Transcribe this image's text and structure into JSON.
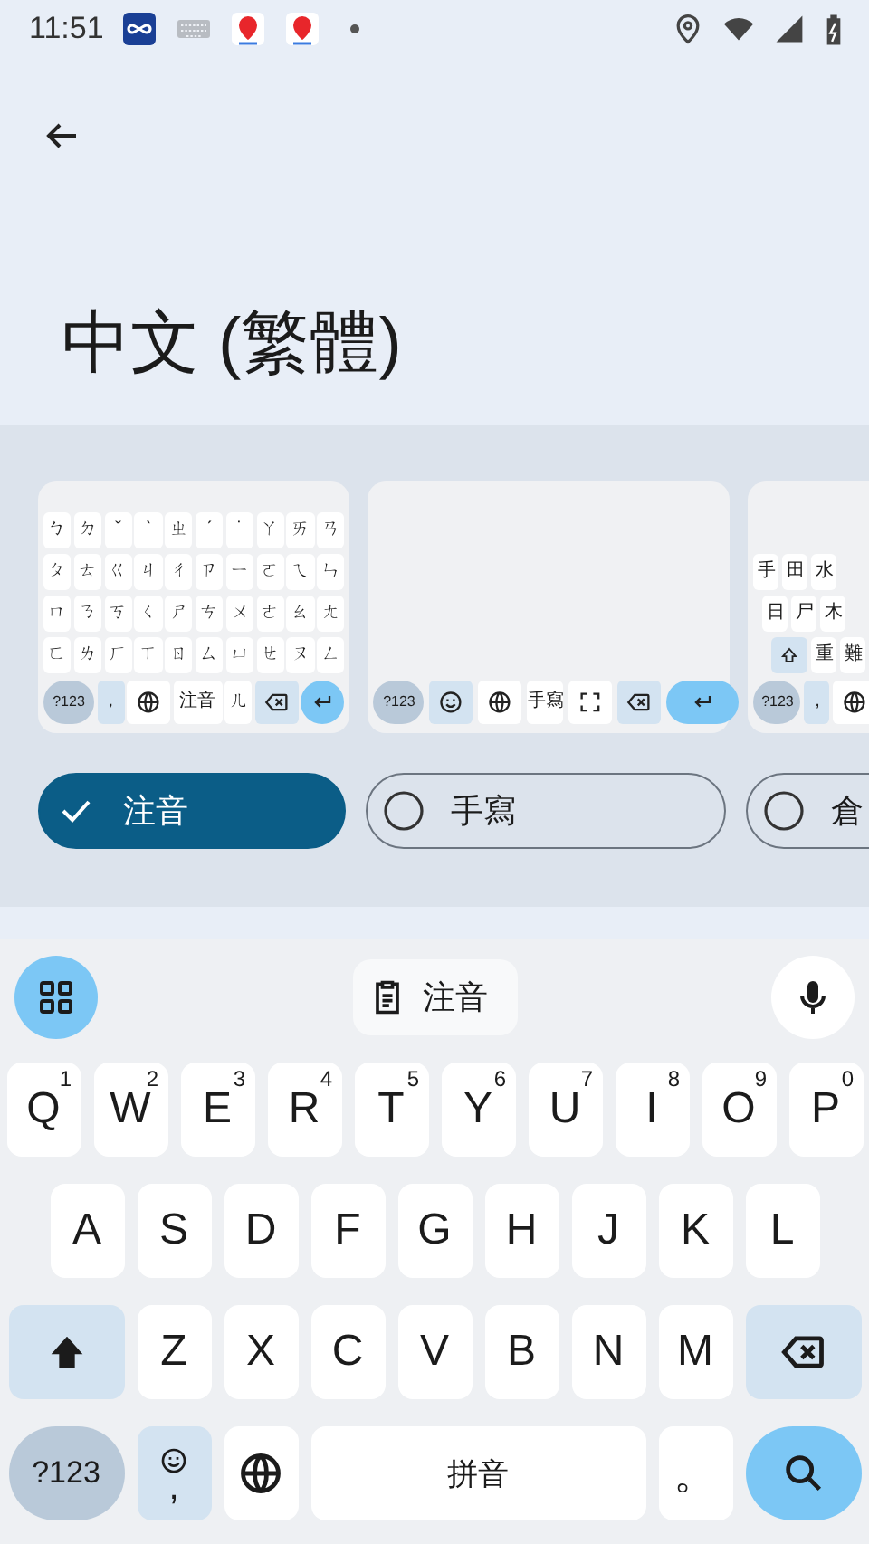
{
  "status_bar": {
    "time": "11:51"
  },
  "title": "中文 (繁體)",
  "layouts": [
    {
      "label": "注音",
      "selected": true,
      "rows": [
        [
          "ㄅ",
          "ㄉ",
          "ˇ",
          "ˋ",
          "ㄓ",
          "ˊ",
          "˙",
          "ㄚ",
          "ㄞ",
          "ㄢ"
        ],
        [
          "ㄆ",
          "ㄊ",
          "ㄍ",
          "ㄐ",
          "ㄔ",
          "ㄗ",
          "ㄧ",
          "ㄛ",
          "ㄟ",
          "ㄣ"
        ],
        [
          "ㄇ",
          "ㄋ",
          "ㄎ",
          "ㄑ",
          "ㄕ",
          "ㄘ",
          "ㄨ",
          "ㄜ",
          "ㄠ",
          "ㄤ"
        ],
        [
          "ㄈ",
          "ㄌ",
          "ㄏ",
          "ㄒ",
          "ㄖ",
          "ㄙ",
          "ㄩ",
          "ㄝ",
          "ㄡ",
          "ㄥ"
        ]
      ],
      "bottom": [
        {
          "kind": "symbols",
          "label": "?123"
        },
        {
          "kind": "comma",
          "label": "，"
        },
        {
          "kind": "globe"
        },
        {
          "kind": "space",
          "label": "注音"
        },
        {
          "kind": "key",
          "label": "ㄦ"
        },
        {
          "kind": "backspace"
        },
        {
          "kind": "enter"
        }
      ]
    },
    {
      "label": "手寫",
      "selected": false,
      "bottom": [
        {
          "kind": "symbols",
          "label": "?123"
        },
        {
          "kind": "emoji"
        },
        {
          "kind": "globe"
        },
        {
          "kind": "space",
          "label": "手寫"
        },
        {
          "kind": "expand"
        },
        {
          "kind": "backspace"
        },
        {
          "kind": "enter"
        }
      ]
    },
    {
      "label": "倉",
      "selected": false,
      "rows": [
        [
          "手",
          "田",
          "水"
        ],
        [
          "日",
          "尸",
          "木"
        ],
        [
          "重",
          "難"
        ]
      ],
      "bottom": [
        {
          "kind": "symbols",
          "label": "?123"
        },
        {
          "kind": "comma",
          "label": ","
        },
        {
          "kind": "globe"
        }
      ]
    }
  ],
  "keyboard": {
    "mode_label": "注音",
    "rows": [
      [
        {
          "kind": "letter",
          "label": "Q",
          "hint": "1"
        },
        {
          "kind": "letter",
          "label": "W",
          "hint": "2"
        },
        {
          "kind": "letter",
          "label": "E",
          "hint": "3"
        },
        {
          "kind": "letter",
          "label": "R",
          "hint": "4"
        },
        {
          "kind": "letter",
          "label": "T",
          "hint": "5"
        },
        {
          "kind": "letter",
          "label": "Y",
          "hint": "6"
        },
        {
          "kind": "letter",
          "label": "U",
          "hint": "7"
        },
        {
          "kind": "letter",
          "label": "I",
          "hint": "8"
        },
        {
          "kind": "letter",
          "label": "O",
          "hint": "9"
        },
        {
          "kind": "letter",
          "label": "P",
          "hint": "0"
        }
      ],
      [
        {
          "kind": "letter",
          "label": "A"
        },
        {
          "kind": "letter",
          "label": "S"
        },
        {
          "kind": "letter",
          "label": "D"
        },
        {
          "kind": "letter",
          "label": "F"
        },
        {
          "kind": "letter",
          "label": "G"
        },
        {
          "kind": "letter",
          "label": "H"
        },
        {
          "kind": "letter",
          "label": "J"
        },
        {
          "kind": "letter",
          "label": "K"
        },
        {
          "kind": "letter",
          "label": "L"
        }
      ],
      [
        {
          "kind": "shift"
        },
        {
          "kind": "letter",
          "label": "Z"
        },
        {
          "kind": "letter",
          "label": "X"
        },
        {
          "kind": "letter",
          "label": "C"
        },
        {
          "kind": "letter",
          "label": "V"
        },
        {
          "kind": "letter",
          "label": "B"
        },
        {
          "kind": "letter",
          "label": "N"
        },
        {
          "kind": "letter",
          "label": "M"
        },
        {
          "kind": "backspace"
        }
      ],
      [
        {
          "kind": "symbols",
          "label": "?123"
        },
        {
          "kind": "comma",
          "label": ","
        },
        {
          "kind": "globe"
        },
        {
          "kind": "space",
          "label": "拼音"
        },
        {
          "kind": "letter",
          "label": "。"
        },
        {
          "kind": "search"
        }
      ]
    ]
  }
}
